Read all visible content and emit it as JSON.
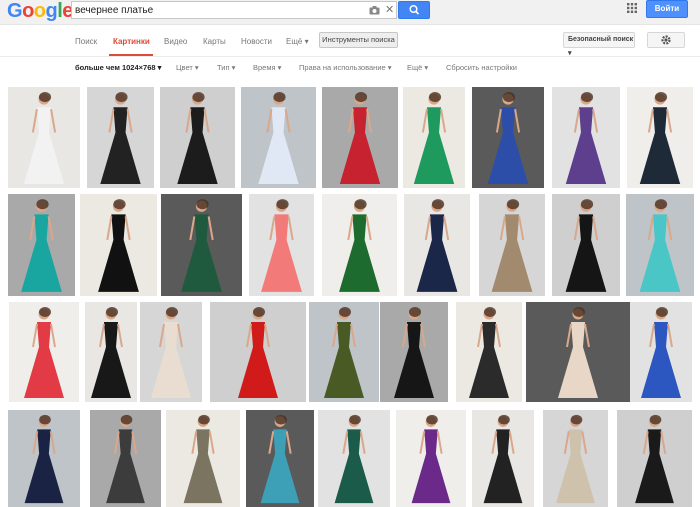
{
  "header": {
    "logo_letters": [
      {
        "ch": "G",
        "color": "#4285f4"
      },
      {
        "ch": "o",
        "color": "#ea4335"
      },
      {
        "ch": "o",
        "color": "#fbbc05"
      },
      {
        "ch": "g",
        "color": "#4285f4"
      },
      {
        "ch": "l",
        "color": "#34a853"
      },
      {
        "ch": "e",
        "color": "#ea4335"
      }
    ],
    "query": "вечернее платье",
    "signin_label": "Войти"
  },
  "nav": {
    "tabs": [
      "Поиск",
      "Картинки",
      "Видео",
      "Карты",
      "Новости",
      "Ещё ▾"
    ],
    "active": "Картинки",
    "search_tools_label": "Инструменты поиска",
    "safesearch_label": "Безопасный поиск ▾"
  },
  "filters": {
    "items": [
      "больше чем 1024×768 ▾",
      "Цвет ▾",
      "Тип ▾",
      "Время ▾",
      "Права на использование ▾",
      "Ещё ▾",
      "Сбросить настройки"
    ]
  },
  "colors": {
    "accent": "#dd4b39",
    "button_blue": "#4285f4"
  },
  "results": {
    "count": 37,
    "dress_colors": [
      "#f2f2f2",
      "#222222",
      "#1c1c1c",
      "#dfe8f4",
      "#c72230",
      "#1f9a5e",
      "#2c4ea8",
      "#5e3f8e",
      "#1e2a38",
      "#1aa6a0",
      "#111111",
      "#1f5a3e",
      "#f27a78",
      "#1d6b2e",
      "#1b2748",
      "#a28a6e",
      "#151515",
      "#4ac6c6",
      "#e23b45",
      "#181818",
      "#e8ddd0",
      "#d11b1b",
      "#4a5a24",
      "#161616",
      "#2b2b2b",
      "#e8d7c6",
      "#2c56c0",
      "#1a2344",
      "#3c3c3c",
      "#7a7460",
      "#3ea0b6",
      "#1b5b4a",
      "#6b2a8a",
      "#222222",
      "#cfc2ad",
      "#1a1a1a"
    ]
  }
}
